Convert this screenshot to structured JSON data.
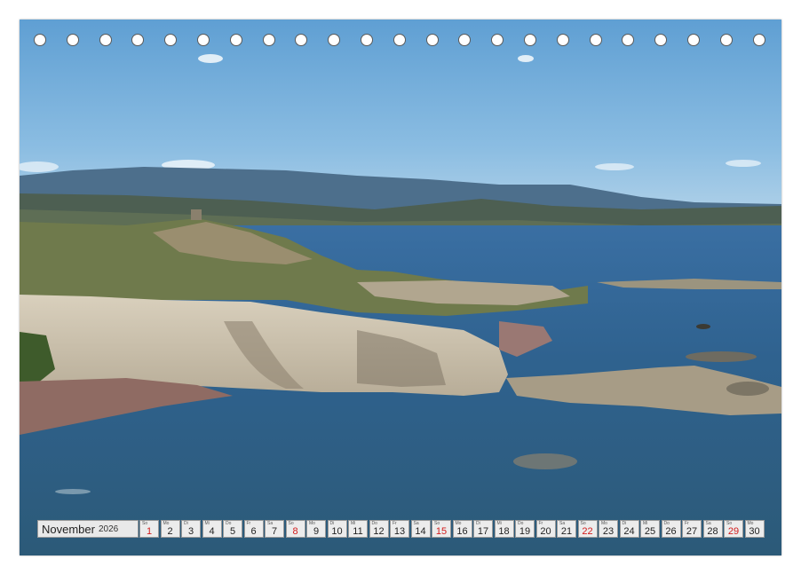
{
  "calendar": {
    "month": "November",
    "year": "2026",
    "days": [
      {
        "wd": "So",
        "num": "1",
        "red": true
      },
      {
        "wd": "Mo",
        "num": "2",
        "red": false
      },
      {
        "wd": "Di",
        "num": "3",
        "red": false
      },
      {
        "wd": "Mi",
        "num": "4",
        "red": false
      },
      {
        "wd": "Do",
        "num": "5",
        "red": false
      },
      {
        "wd": "Fr",
        "num": "6",
        "red": false
      },
      {
        "wd": "Sa",
        "num": "7",
        "red": false
      },
      {
        "wd": "So",
        "num": "8",
        "red": true
      },
      {
        "wd": "Mo",
        "num": "9",
        "red": false
      },
      {
        "wd": "Di",
        "num": "10",
        "red": false
      },
      {
        "wd": "Mi",
        "num": "11",
        "red": false
      },
      {
        "wd": "Do",
        "num": "12",
        "red": false
      },
      {
        "wd": "Fr",
        "num": "13",
        "red": false
      },
      {
        "wd": "Sa",
        "num": "14",
        "red": false
      },
      {
        "wd": "So",
        "num": "15",
        "red": true
      },
      {
        "wd": "Mo",
        "num": "16",
        "red": false
      },
      {
        "wd": "Di",
        "num": "17",
        "red": false
      },
      {
        "wd": "Mi",
        "num": "18",
        "red": false
      },
      {
        "wd": "Do",
        "num": "19",
        "red": false
      },
      {
        "wd": "Fr",
        "num": "20",
        "red": false
      },
      {
        "wd": "Sa",
        "num": "21",
        "red": false
      },
      {
        "wd": "So",
        "num": "22",
        "red": true
      },
      {
        "wd": "Mo",
        "num": "23",
        "red": false
      },
      {
        "wd": "Di",
        "num": "24",
        "red": false
      },
      {
        "wd": "Mi",
        "num": "25",
        "red": false
      },
      {
        "wd": "Do",
        "num": "26",
        "red": false
      },
      {
        "wd": "Fr",
        "num": "27",
        "red": false
      },
      {
        "wd": "Sa",
        "num": "28",
        "red": false
      },
      {
        "wd": "So",
        "num": "29",
        "red": true
      },
      {
        "wd": "Mo",
        "num": "30",
        "red": false
      }
    ]
  },
  "binding": {
    "ring_count": 23
  },
  "colors": {
    "holiday": "#d21c1c",
    "sea": "#2f5f86",
    "sky": "#7fb3dc"
  }
}
